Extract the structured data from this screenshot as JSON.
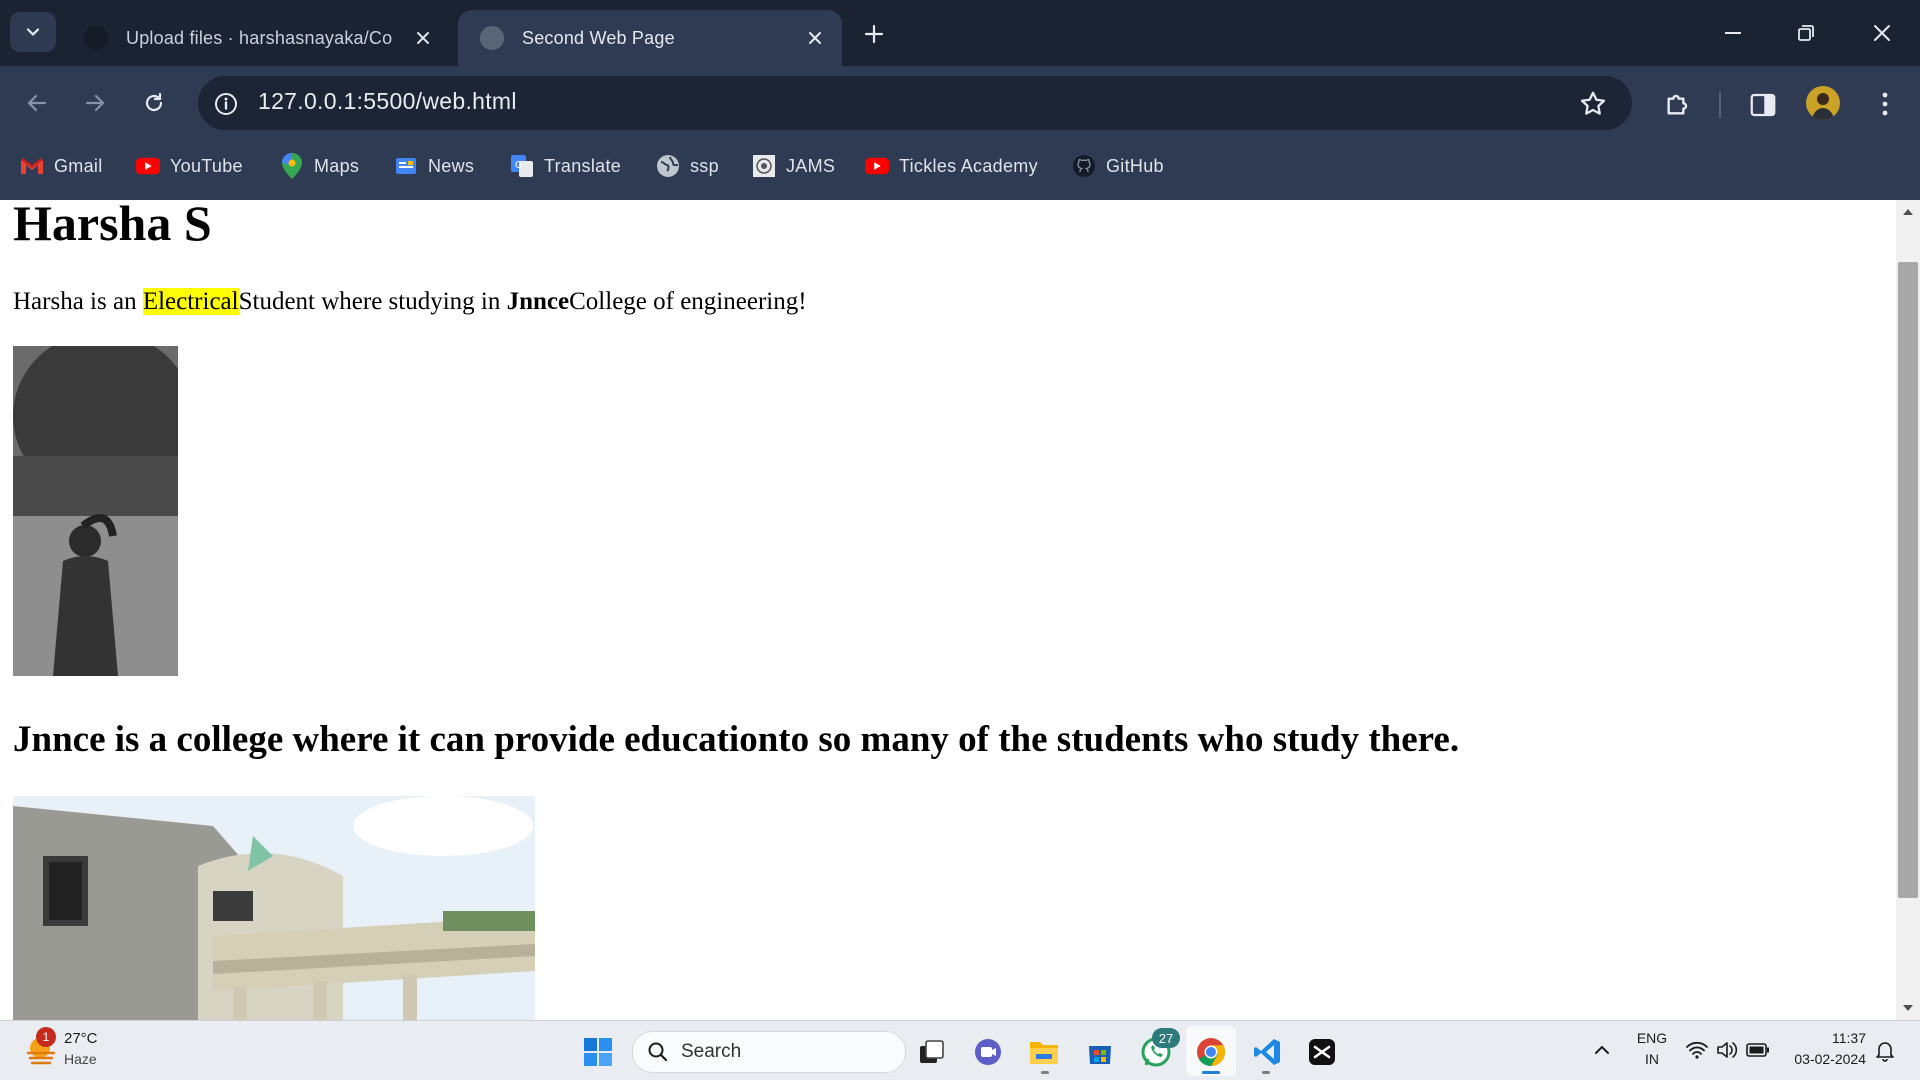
{
  "browser": {
    "tabs": [
      {
        "title": "Upload files · harshasnayaka/Co",
        "active": false
      },
      {
        "title": "Second Web Page",
        "active": true
      }
    ],
    "url": "127.0.0.1:5500/web.html",
    "bookmarks": [
      {
        "label": "Gmail",
        "icon": "gmail-icon"
      },
      {
        "label": "YouTube",
        "icon": "youtube-icon"
      },
      {
        "label": "Maps",
        "icon": "maps-icon"
      },
      {
        "label": "News",
        "icon": "news-icon"
      },
      {
        "label": "Translate",
        "icon": "translate-icon"
      },
      {
        "label": "ssp",
        "icon": "globe-icon"
      },
      {
        "label": "JAMS",
        "icon": "jams-icon"
      },
      {
        "label": "Tickles Academy",
        "icon": "youtube-icon"
      },
      {
        "label": "GitHub",
        "icon": "github-icon"
      }
    ],
    "colors": {
      "tabstrip": "#1b2333",
      "toolbar": "#2f3b52",
      "omnibox": "#1c2436",
      "highlight": "#ffff00"
    }
  },
  "page": {
    "heading": "Harsha S",
    "para_part1": "Harsha is an ",
    "para_highlight": "Electrical",
    "para_part2": "Student where studying in ",
    "para_bold": "Jnnce",
    "para_part3": "College of engineering!",
    "subheading": "Jnnce is a college where it can provide educationto so many of the students who study there."
  },
  "taskbar": {
    "weather_badge": "1",
    "temperature": "27°C",
    "condition": "Haze",
    "search_placeholder": "Search",
    "whatsapp_badge": "27",
    "language": "ENG",
    "region": "IN",
    "time": "11:37",
    "date": "03-02-2024"
  }
}
